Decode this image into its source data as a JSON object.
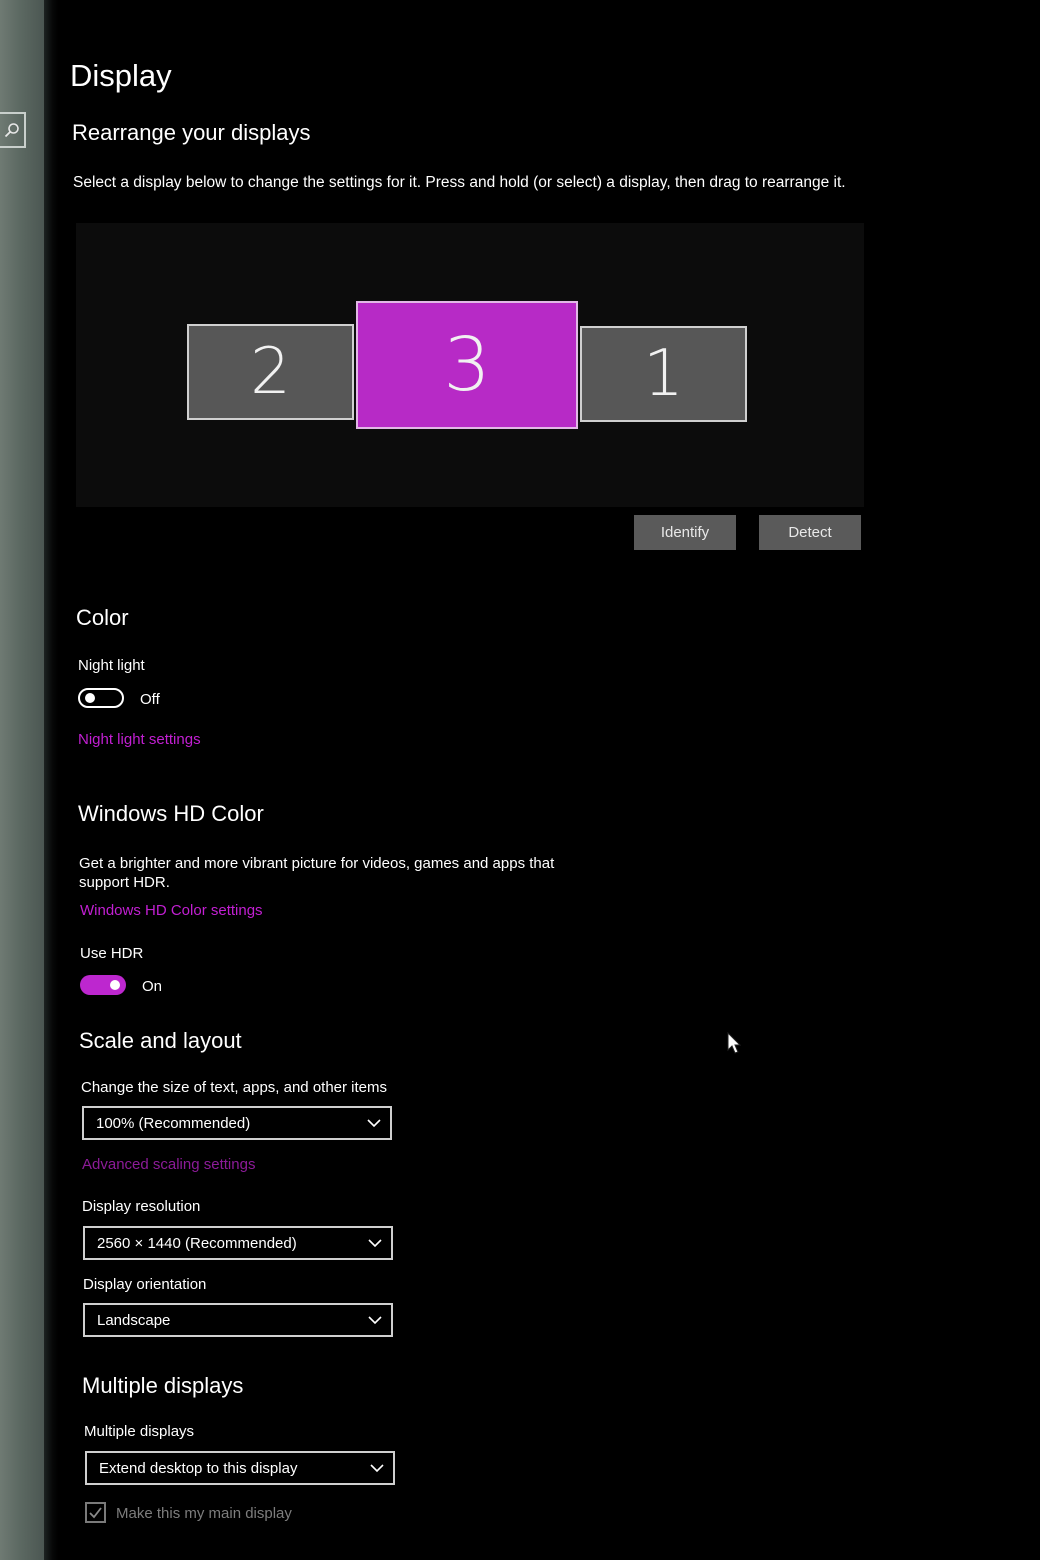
{
  "page": {
    "title": "Display",
    "accent_color": "#bd27cf"
  },
  "sidebar": {
    "search_icon": "search-icon"
  },
  "rearrange": {
    "heading": "Rearrange your displays",
    "description": "Select a display below to change the settings for it. Press and hold (or select) a display, then drag to rearrange it.",
    "monitors": [
      {
        "number": "2",
        "selected": false
      },
      {
        "number": "3",
        "selected": true
      },
      {
        "number": "1",
        "selected": false
      }
    ],
    "identify_label": "Identify",
    "detect_label": "Detect"
  },
  "color": {
    "heading": "Color",
    "night_light_label": "Night light",
    "night_light_state": "Off",
    "night_light_settings_link": "Night light settings"
  },
  "hd_color": {
    "heading": "Windows HD Color",
    "description_line1": "Get a brighter and more vibrant picture for videos, games and apps that",
    "description_line2": "support HDR.",
    "settings_link": "Windows HD Color settings",
    "use_hdr_label": "Use HDR",
    "use_hdr_state": "On"
  },
  "scale_layout": {
    "heading": "Scale and layout",
    "scale_label": "Change the size of text, apps, and other items",
    "scale_value": "100% (Recommended)",
    "advanced_link": "Advanced scaling settings",
    "resolution_label": "Display resolution",
    "resolution_value": "2560 × 1440 (Recommended)",
    "orientation_label": "Display orientation",
    "orientation_value": "Landscape"
  },
  "multiple_displays": {
    "heading": "Multiple displays",
    "label": "Multiple displays",
    "value": "Extend desktop to this display",
    "main_display_checkbox": "Make this my main display"
  }
}
